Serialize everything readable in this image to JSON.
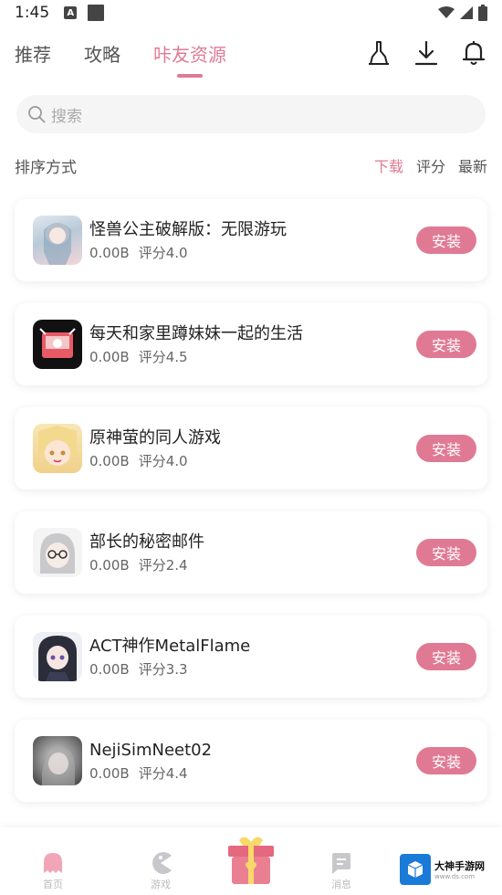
{
  "status_bar": {
    "time": "1:45",
    "a_icon": "A"
  },
  "nav": {
    "tabs": [
      {
        "label": "推荐",
        "active": false
      },
      {
        "label": "攻略",
        "active": false
      },
      {
        "label": "咔友资源",
        "active": true
      }
    ],
    "icons": [
      "broom-icon",
      "download-icon",
      "bell-icon"
    ]
  },
  "search": {
    "placeholder": "搜索"
  },
  "sort": {
    "label": "排序方式",
    "options": [
      {
        "label": "下载",
        "active": true
      },
      {
        "label": "评分",
        "active": false
      },
      {
        "label": "最新",
        "active": false
      }
    ]
  },
  "games": [
    {
      "title": "怪兽公主破解版：无限游玩",
      "size": "0.00B",
      "rating": "评分4.0",
      "button": "安装"
    },
    {
      "title": "每天和家里蹲妹妹一起的生活",
      "size": "0.00B",
      "rating": "评分4.5",
      "button": "安装"
    },
    {
      "title": "原神萤的同人游戏",
      "size": "0.00B",
      "rating": "评分4.0",
      "button": "安装"
    },
    {
      "title": "部长的秘密邮件",
      "size": "0.00B",
      "rating": "评分2.4",
      "button": "安装"
    },
    {
      "title": "ACT神作MetalFlame",
      "size": "0.00B",
      "rating": "评分3.3",
      "button": "安装"
    },
    {
      "title": "NejiSimNeet02",
      "size": "0.00B",
      "rating": "评分4.4",
      "button": "安装"
    }
  ],
  "bottom_nav": {
    "items": [
      {
        "label": "首页",
        "icon": "ghost-icon"
      },
      {
        "label": "游戏",
        "icon": "pacman-icon"
      },
      {
        "label": "消息",
        "icon": "message-icon"
      }
    ]
  },
  "watermark": {
    "title": "大神手游网",
    "sub": "www.ds.com"
  },
  "colors": {
    "accent": "#e07a94",
    "text": "#222222",
    "muted": "#666666"
  }
}
